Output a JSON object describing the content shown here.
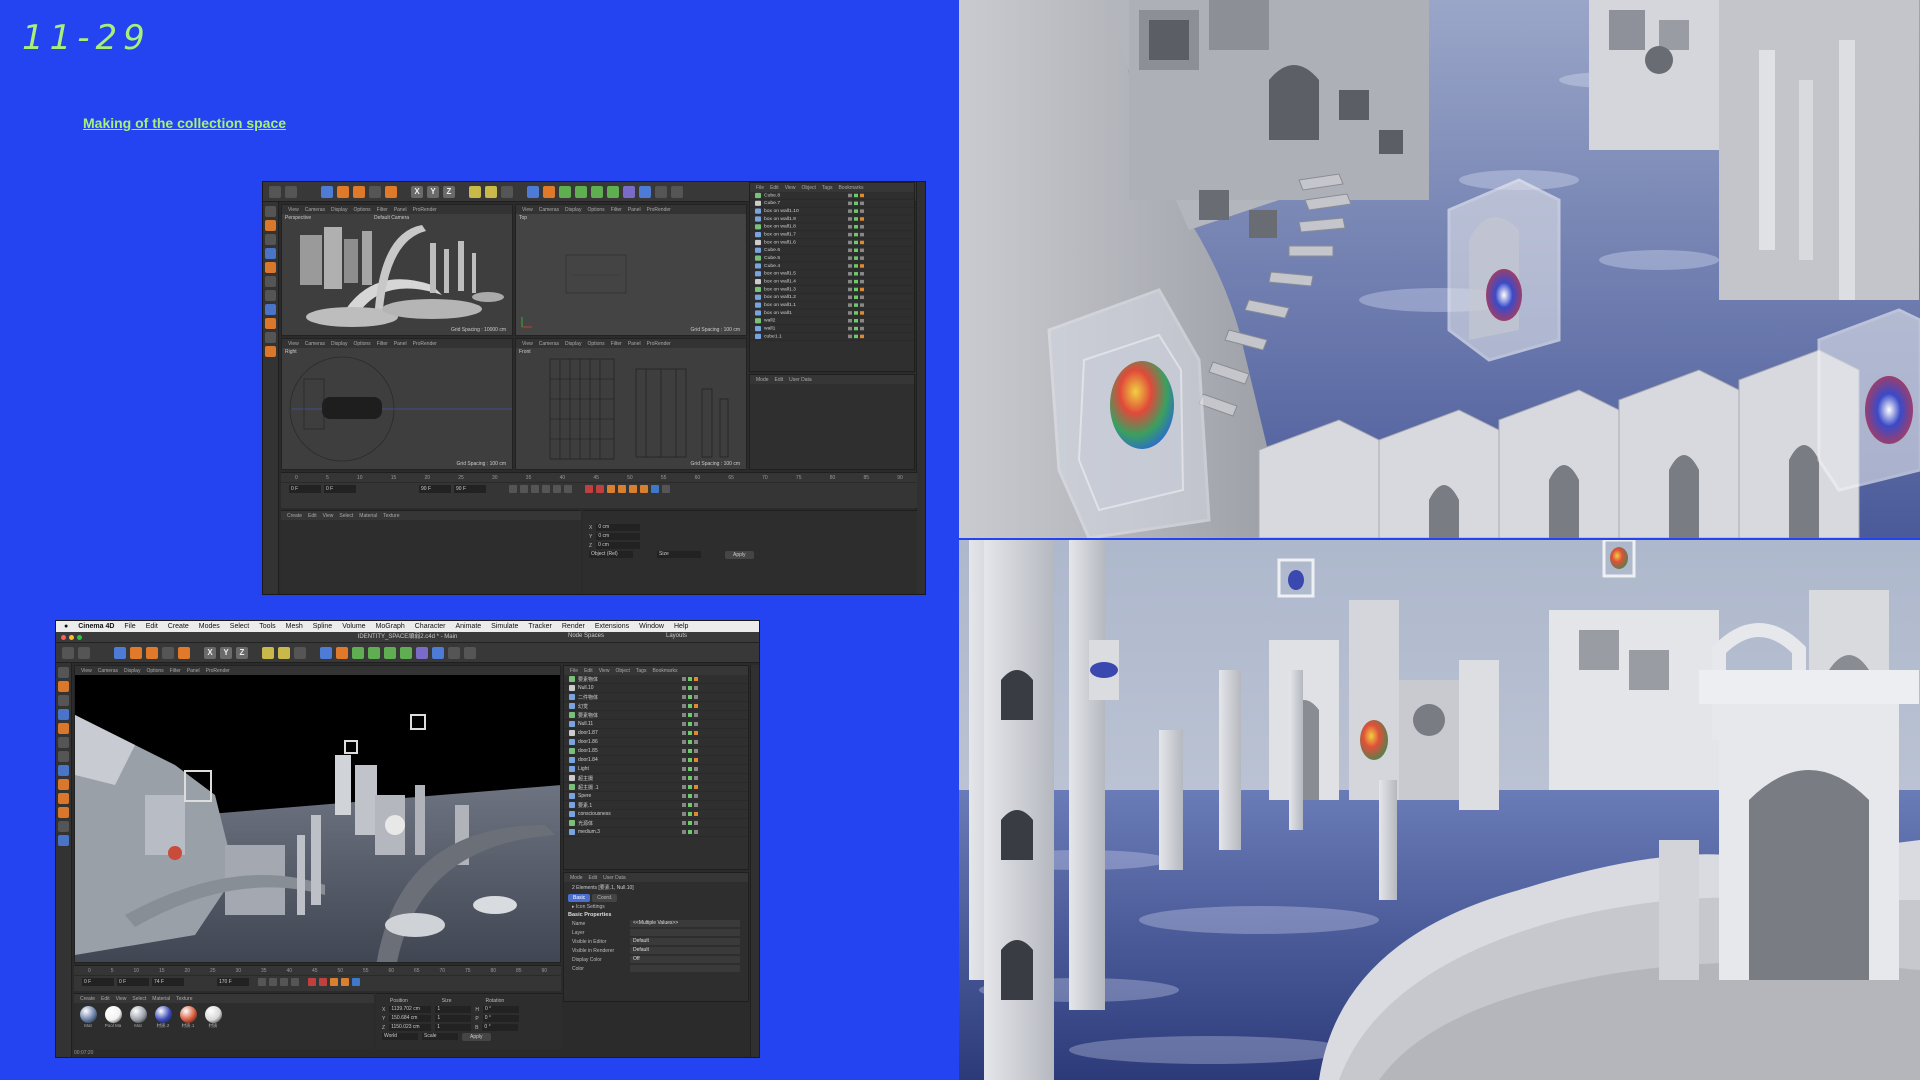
{
  "slide": {
    "page_number": "11-29",
    "subtitle": "Making of the collection space"
  },
  "window_top": {
    "viewport_menu": [
      "View",
      "Cameras",
      "Display",
      "Options",
      "Filter",
      "Panel",
      "ProRender"
    ],
    "viewports": [
      {
        "label": "Perspective",
        "camera": "Default Camera",
        "grid": "Grid Spacing : 10000 cm"
      },
      {
        "label": "Top",
        "camera": "",
        "grid": "Grid Spacing : 100 cm"
      },
      {
        "label": "Right",
        "camera": "",
        "grid": "Grid Spacing : 100 cm"
      },
      {
        "label": "Front",
        "camera": "",
        "grid": "Grid Spacing : 100 cm"
      }
    ],
    "object_menu": [
      "File",
      "Edit",
      "View",
      "Object",
      "Tags",
      "Bookmarks"
    ],
    "objects": [
      "Cube.8",
      "Cube.7",
      "box on wall1.10",
      "box on wall1.9",
      "box on wall1.8",
      "box on wall1.7",
      "box on wall1.6",
      "Cube.6",
      "Cube.5",
      "Cube.4",
      "box on wall1.5",
      "box on wall1.4",
      "box on wall1.3",
      "box on wall1.2",
      "box on wall1.1",
      "box on wall1",
      "wall2",
      "wall1",
      "cube1.1"
    ],
    "attr_menu": [
      "Mode",
      "Edit",
      "User Data"
    ],
    "ruler": [
      "0",
      "5",
      "10",
      "15",
      "20",
      "25",
      "30",
      "35",
      "40",
      "45",
      "50",
      "55",
      "60",
      "65",
      "70",
      "75",
      "80",
      "85",
      "90"
    ],
    "time_fields": [
      "0 F",
      "0 F",
      "90 F",
      "90 F"
    ],
    "material_menu": [
      "Create",
      "Edit",
      "View",
      "Select",
      "Material",
      "Texture"
    ],
    "coord_labels": [
      "X",
      "Y",
      "Z"
    ],
    "coord_values": [
      "0 cm",
      "0 cm",
      "0 cm"
    ],
    "coord_mode": "Object (Rel)",
    "size_mode": "Size",
    "apply": "Apply"
  },
  "window_bottom": {
    "mac_menu": [
      "Cinema 4D",
      "File",
      "Edit",
      "Create",
      "Modes",
      "Select",
      "Tools",
      "Mesh",
      "Spline",
      "Volume",
      "MoGraph",
      "Character",
      "Animate",
      "Simulate",
      "Tracker",
      "Render",
      "Extensions",
      "Window",
      "Help"
    ],
    "title": "IDENTITY_SPACE頑弱2.c4d * - Main",
    "node_spaces": "Node Spaces",
    "layouts": "Layouts",
    "viewport_menu": [
      "View",
      "Cameras",
      "Display",
      "Options",
      "Filter",
      "Panel",
      "ProRender"
    ],
    "object_menu": [
      "File",
      "Edit",
      "View",
      "Object",
      "Tags",
      "Bookmarks"
    ],
    "objects": [
      "要素物体",
      "Null.10",
      "二件物体",
      "幻觉",
      "要素物体",
      "Null.11",
      "door1.87",
      "door1.86",
      "door1.85",
      "door1.84",
      "Light",
      "超主摄",
      "超主摄 .1",
      "Spere",
      "要素.1",
      "consciousness",
      "光源体",
      "medium.3"
    ],
    "attr_menu": [
      "Mode",
      "Edit",
      "User Data"
    ],
    "attr_elements": "2 Elements [要素.1, Null.10]",
    "attr_tabs": [
      "Basic",
      "Coord."
    ],
    "icon_settings": "▸ Icon Settings",
    "basic_properties": "Basic Properties",
    "attr_rows": [
      {
        "label": "Name",
        "value": "<<Multiple Values>>"
      },
      {
        "label": "Layer",
        "value": ""
      },
      {
        "label": "Visible in Editor",
        "value": "Default"
      },
      {
        "label": "Visible in Renderer",
        "value": "Default"
      },
      {
        "label": "Display Color",
        "value": "Off"
      },
      {
        "label": "Color",
        "value": ""
      }
    ],
    "ruler": [
      "0",
      "5",
      "10",
      "15",
      "20",
      "25",
      "30",
      "35",
      "40",
      "45",
      "50",
      "55",
      "60",
      "65",
      "70",
      "75",
      "80",
      "85",
      "90"
    ],
    "time_fields": [
      "0 F",
      "0 F",
      "74 F",
      "170 F"
    ],
    "material_menu": [
      "Create",
      "Edit",
      "View",
      "Select",
      "Material",
      "Texture"
    ],
    "materials": [
      {
        "name": "Mat",
        "color": "#6a7fa8"
      },
      {
        "name": "Pool Ma",
        "color": "#f2f2f2"
      },
      {
        "name": "Mat",
        "color": "#9aa0aa"
      },
      {
        "name": "材质.2",
        "color": "#3b4bb8"
      },
      {
        "name": "材质.1",
        "color": "#d85a3a"
      },
      {
        "name": "材质",
        "color": "#d8d8d8"
      }
    ],
    "coord_headers": [
      "Position",
      "Size",
      "Rotation"
    ],
    "coord_rows": [
      {
        "axis": "X",
        "pos": "1139.702 cm",
        "size": "1",
        "rot_axis": "H",
        "rot": "0 °"
      },
      {
        "axis": "Y",
        "pos": "150.684 cm",
        "size": "1",
        "rot_axis": "P",
        "rot": "0 °"
      },
      {
        "axis": "Z",
        "pos": "1150.023 cm",
        "size": "1",
        "rot_axis": "B",
        "rot": "0 °"
      }
    ],
    "coord_mode": "World",
    "size_mode": "Scale",
    "apply": "Apply",
    "status": "00:07:20"
  },
  "colors": {
    "background": "#2344f0",
    "accent": "#a8f07a"
  }
}
